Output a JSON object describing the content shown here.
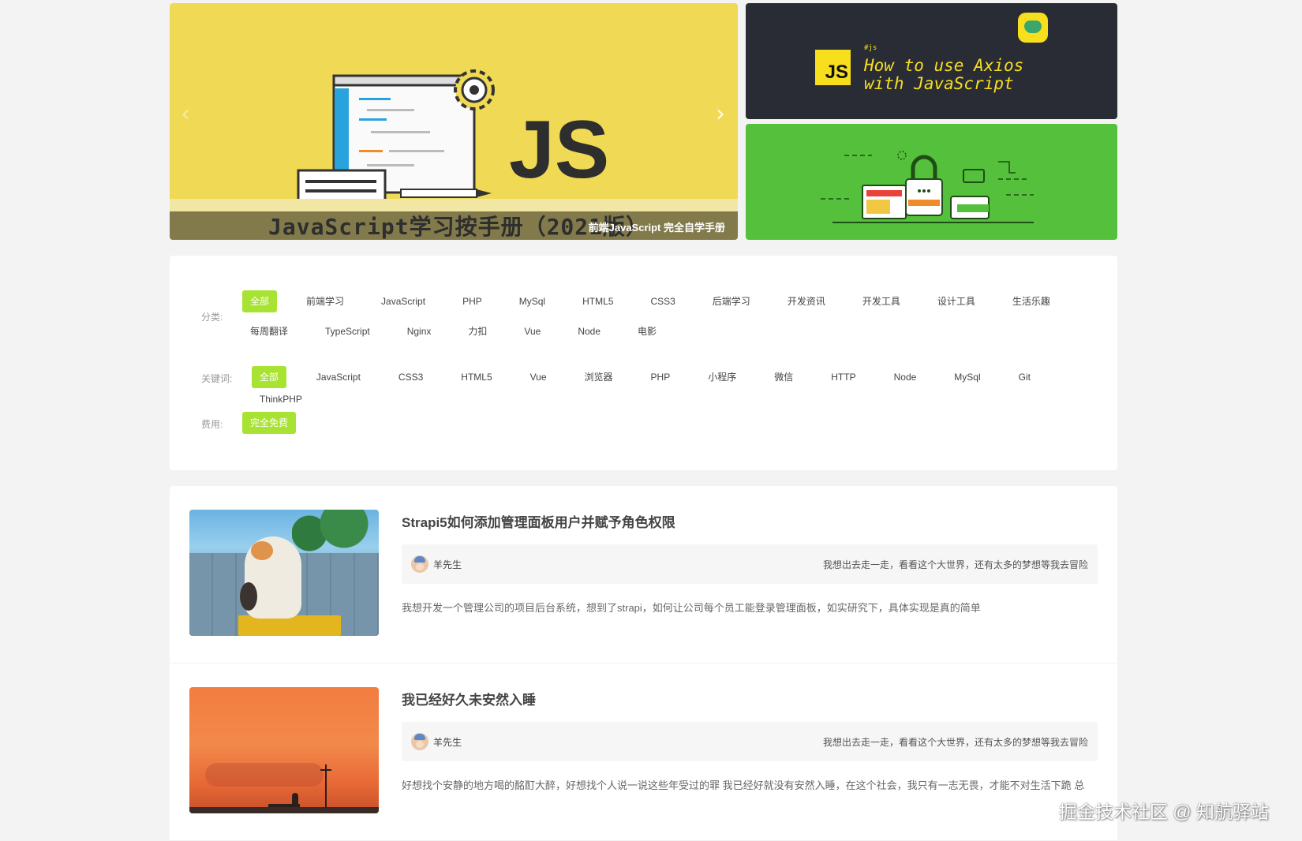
{
  "carousel": {
    "slide_title": "JavaScript学习按手册（2021版）",
    "slide_mark": "JS",
    "caption": "前端JavaScript 完全自学手册",
    "prev_icon": "chevron-left-icon",
    "next_icon": "chevron-right-icon"
  },
  "side_banners": [
    {
      "logo_text": "JS",
      "tag": "#js",
      "line1": "How to use Axios",
      "line2": "with JavaScript",
      "bg": "#292c35",
      "accent": "#f7df1e"
    },
    {
      "illustration": "secure-online-shop",
      "bg": "#55c03b"
    }
  ],
  "filters": {
    "category": {
      "label": "分类:",
      "items": [
        "全部",
        "前端学习",
        "JavaScript",
        "PHP",
        "MySql",
        "HTML5",
        "CSS3",
        "后端学习",
        "开发资讯",
        "开发工具",
        "设计工具",
        "生活乐趣",
        "每周翻译",
        "TypeScript",
        "Nginx",
        "力扣",
        "Vue",
        "Node",
        "电影"
      ],
      "active": 0
    },
    "keyword": {
      "label": "关键词:",
      "items": [
        "全部",
        "JavaScript",
        "CSS3",
        "HTML5",
        "Vue",
        "浏览器",
        "PHP",
        "小程序",
        "微信",
        "HTTP",
        "Node",
        "MySql",
        "Git",
        "ThinkPHP"
      ],
      "active": 0
    },
    "fee": {
      "label": "费用:",
      "items": [
        "完全免费"
      ],
      "active": 0
    },
    "accent": "#a8e232"
  },
  "articles": [
    {
      "title": "Strapi5如何添加管理面板用户并赋予角色权限",
      "author": "羊先生",
      "motto": "我想出去走一走，看看这个大世界，还有太多的梦想等我去冒险",
      "desc": "我想开发一个管理公司的项目后台系统，想到了strapi，如何让公司每个员工能登录管理面板，如实研究下，具体实现是真的简单",
      "thumb": "cat-on-wall"
    },
    {
      "title": "我已经好久未安然入睡",
      "author": "羊先生",
      "motto": "我想出去走一走，看看这个大世界，还有太多的梦想等我去冒险",
      "desc": "好想找个安静的地方喝的酩酊大醉，好想找个人说一说这些年受过的罪 我已经好就没有安然入睡，在这个社会，我只有一志无畏，才能不对生活下跪 总",
      "thumb": "sunset-silhouette"
    }
  ],
  "watermark": "掘金技术社区 @ 知航驿站"
}
